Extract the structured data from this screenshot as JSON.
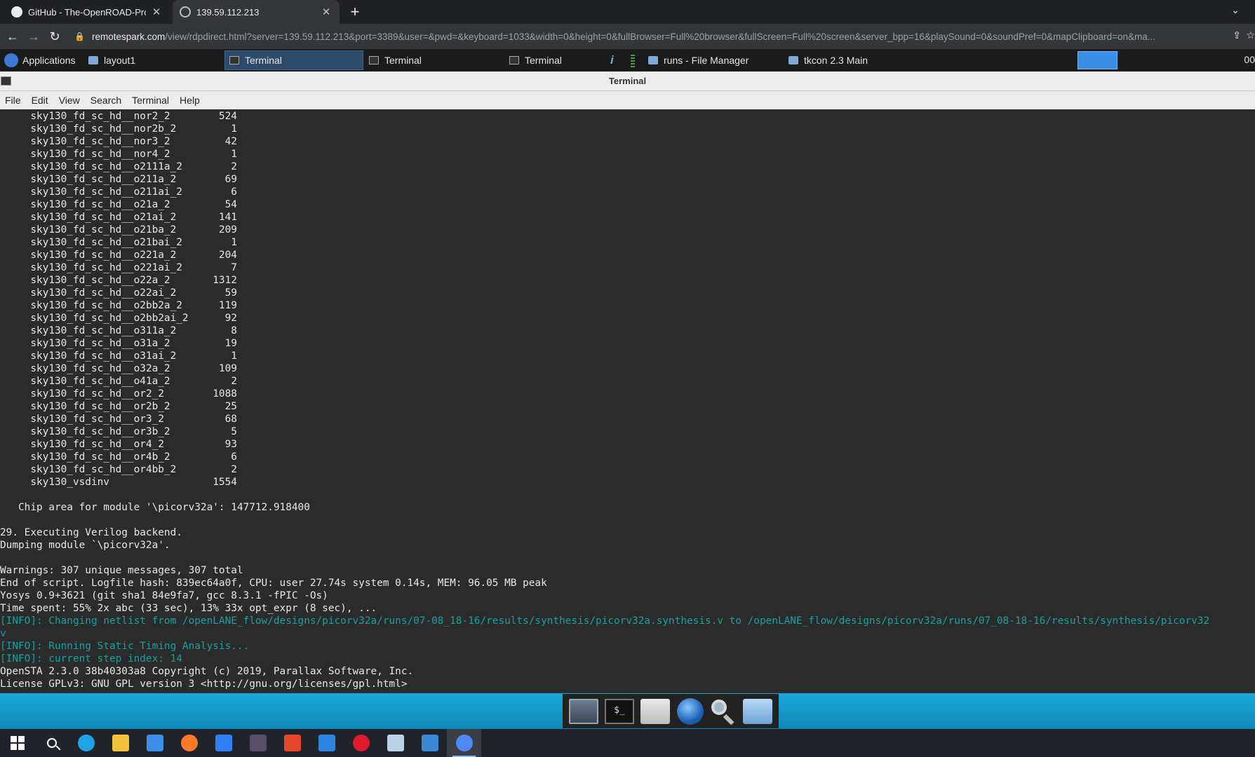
{
  "browser": {
    "tabs": [
      {
        "title": "GitHub - The-OpenROAD-Project",
        "active": false
      },
      {
        "title": "139.59.112.213",
        "active": true
      }
    ],
    "new_tab_label": "+",
    "url_host": "remotespark.com",
    "url_path": "/view/rdpdirect.html?server=139.59.112.213&port=3389&user=&pwd=&keyboard=1033&width=0&height=0&fullBrowser=Full%20browser&fullScreen=Full%20screen&server_bpp=16&playSound=0&soundPref=0&mapClipboard=on&ma..."
  },
  "panel": {
    "applications_label": "Applications",
    "buttons": [
      {
        "label": "layout1",
        "icon": "window-icon"
      },
      {
        "label": "Terminal",
        "icon": "terminal-icon",
        "active": true
      },
      {
        "label": "Terminal",
        "icon": "terminal-icon"
      },
      {
        "label": "Terminal",
        "icon": "terminal-icon"
      },
      {
        "label": "runs - File Manager",
        "icon": "folder-icon"
      },
      {
        "label": "tkcon 2.3 Main",
        "icon": "window-icon"
      }
    ],
    "clock": "00"
  },
  "window": {
    "title": "Terminal",
    "menus": [
      "File",
      "Edit",
      "View",
      "Search",
      "Terminal",
      "Help"
    ]
  },
  "terminal": {
    "cell_rows": [
      [
        "sky130_fd_sc_hd__nor2_2",
        "524"
      ],
      [
        "sky130_fd_sc_hd__nor2b_2",
        "1"
      ],
      [
        "sky130_fd_sc_hd__nor3_2",
        "42"
      ],
      [
        "sky130_fd_sc_hd__nor4_2",
        "1"
      ],
      [
        "sky130_fd_sc_hd__o2111a_2",
        "2"
      ],
      [
        "sky130_fd_sc_hd__o211a_2",
        "69"
      ],
      [
        "sky130_fd_sc_hd__o211ai_2",
        "6"
      ],
      [
        "sky130_fd_sc_hd__o21a_2",
        "54"
      ],
      [
        "sky130_fd_sc_hd__o21ai_2",
        "141"
      ],
      [
        "sky130_fd_sc_hd__o21ba_2",
        "209"
      ],
      [
        "sky130_fd_sc_hd__o21bai_2",
        "1"
      ],
      [
        "sky130_fd_sc_hd__o221a_2",
        "204"
      ],
      [
        "sky130_fd_sc_hd__o221ai_2",
        "7"
      ],
      [
        "sky130_fd_sc_hd__o22a_2",
        "1312"
      ],
      [
        "sky130_fd_sc_hd__o22ai_2",
        "59"
      ],
      [
        "sky130_fd_sc_hd__o2bb2a_2",
        "119"
      ],
      [
        "sky130_fd_sc_hd__o2bb2ai_2",
        "92"
      ],
      [
        "sky130_fd_sc_hd__o311a_2",
        "8"
      ],
      [
        "sky130_fd_sc_hd__o31a_2",
        "19"
      ],
      [
        "sky130_fd_sc_hd__o31ai_2",
        "1"
      ],
      [
        "sky130_fd_sc_hd__o32a_2",
        "109"
      ],
      [
        "sky130_fd_sc_hd__o41a_2",
        "2"
      ],
      [
        "sky130_fd_sc_hd__or2_2",
        "1088"
      ],
      [
        "sky130_fd_sc_hd__or2b_2",
        "25"
      ],
      [
        "sky130_fd_sc_hd__or3_2",
        "68"
      ],
      [
        "sky130_fd_sc_hd__or3b_2",
        "5"
      ],
      [
        "sky130_fd_sc_hd__or4_2",
        "93"
      ],
      [
        "sky130_fd_sc_hd__or4b_2",
        "6"
      ],
      [
        "sky130_fd_sc_hd__or4bb_2",
        "2"
      ],
      [
        "sky130_vsdinv",
        "1554"
      ]
    ],
    "tail_lines": [
      {
        "text": "",
        "kind": "normal"
      },
      {
        "text": "   Chip area for module '\\picorv32a': 147712.918400",
        "kind": "normal"
      },
      {
        "text": "",
        "kind": "normal"
      },
      {
        "text": "29. Executing Verilog backend.",
        "kind": "normal"
      },
      {
        "text": "Dumping module `\\picorv32a'.",
        "kind": "normal"
      },
      {
        "text": "",
        "kind": "normal"
      },
      {
        "text": "Warnings: 307 unique messages, 307 total",
        "kind": "normal"
      },
      {
        "text": "End of script. Logfile hash: 839ec64a0f, CPU: user 27.74s system 0.14s, MEM: 96.05 MB peak",
        "kind": "normal"
      },
      {
        "text": "Yosys 0.9+3621 (git sha1 84e9fa7, gcc 8.3.1 -fPIC -Os)",
        "kind": "normal"
      },
      {
        "text": "Time spent: 55% 2x abc (33 sec), 13% 33x opt_expr (8 sec), ...",
        "kind": "normal"
      },
      {
        "text": "[INFO]: Changing netlist from /openLANE_flow/designs/picorv32a/runs/07-08_18-16/results/synthesis/picorv32a.synthesis.v to /openLANE_flow/designs/picorv32a/runs/07_08-18-16/results/synthesis/picorv32",
        "kind": "info"
      },
      {
        "text": "v",
        "kind": "info"
      },
      {
        "text": "[INFO]: Running Static Timing Analysis...",
        "kind": "info"
      },
      {
        "text": "[INFO]: current step index: 14",
        "kind": "info"
      },
      {
        "text": "OpenSTA 2.3.0 38b40303a8 Copyright (c) 2019, Parallax Software, Inc.",
        "kind": "normal"
      },
      {
        "text": "License GPLv3: GNU GPL version 3 <http://gnu.org/licenses/gpl.html>",
        "kind": "normal"
      }
    ]
  },
  "dock": {
    "items": [
      "desktop-icon",
      "terminal-icon",
      "home-folder-icon",
      "web-browser-icon",
      "search-icon",
      "folder-icon"
    ],
    "terminal_glyph": "$_"
  },
  "taskbar": {
    "items": [
      {
        "name": "start-icon",
        "color": "#ffffff"
      },
      {
        "name": "search-icon",
        "color": "#ffffff"
      },
      {
        "name": "edge-icon",
        "color": "#1fa3e4"
      },
      {
        "name": "file-explorer-icon",
        "color": "#f2c33c"
      },
      {
        "name": "store-icon",
        "color": "#3c8ee8"
      },
      {
        "name": "firefox-icon",
        "color": "#ff7a2a"
      },
      {
        "name": "dropbox-icon",
        "color": "#2f7ff7"
      },
      {
        "name": "game-icon",
        "color": "#5a4d6b"
      },
      {
        "name": "office-icon",
        "color": "#e5452b"
      },
      {
        "name": "mail-icon",
        "color": "#2a86e0"
      },
      {
        "name": "opera-icon",
        "color": "#e0192d"
      },
      {
        "name": "notes-icon",
        "color": "#b9d2e6"
      },
      {
        "name": "photos-icon",
        "color": "#3c86d6"
      },
      {
        "name": "chrome-icon",
        "color": "#4c8bf5",
        "active": true
      }
    ]
  }
}
